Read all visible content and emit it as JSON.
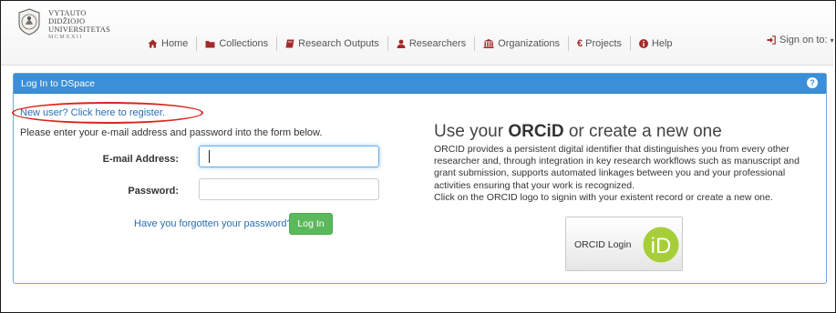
{
  "logo": {
    "lines": [
      "VYTAUTO",
      "DIDŽIOJO",
      "UNIVERSITETAS",
      "MCMXXII"
    ]
  },
  "nav": {
    "items": [
      {
        "label": "Home",
        "icon": "home-icon"
      },
      {
        "label": "Collections",
        "icon": "folder-icon"
      },
      {
        "label": "Research Outputs",
        "icon": "book-icon"
      },
      {
        "label": "Researchers",
        "icon": "user-icon"
      },
      {
        "label": "Organizations",
        "icon": "institution-icon"
      },
      {
        "label": "Projects",
        "icon": "euro-icon"
      },
      {
        "label": "Help",
        "icon": "info-icon"
      }
    ],
    "signon": "Sign on to:"
  },
  "panel": {
    "title": "Log In to DSpace"
  },
  "login": {
    "register_link": "New user? Click here to register.",
    "instructions": "Please enter your e-mail address and password into the form below.",
    "email_label": "E-mail Address:",
    "email_value": "",
    "password_label": "Password:",
    "password_value": "",
    "forgot_link": "Have you forgotten your password?",
    "submit_label": "Log In"
  },
  "orcid": {
    "title_prefix": "Use your ",
    "title_brand": "ORCiD",
    "title_suffix": " or create a new one",
    "paragraph": "ORCID provides a persistent digital identifier that distinguishes you from every other researcher and, through integration in key research workflows such as manuscript and grant submission, supports automated linkages between you and your professional activities ensuring that your work is recognized.",
    "paragraph2": "Click on the ORCID logo to signin with your existent record or create a new one.",
    "button_label": "ORCID Login",
    "logo_text": "iD"
  },
  "colors": {
    "panel_header": "#3a8fd8",
    "link": "#2a6db5",
    "login_button": "#5cb85c",
    "orcid_green": "#a6ce39",
    "annotation_oval": "#d9261c"
  }
}
